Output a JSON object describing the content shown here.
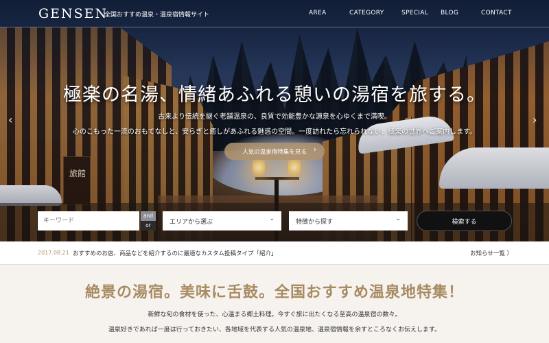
{
  "header": {
    "logo": "GENSEN",
    "tagline": "全国おすすめ温泉・温泉宿情報サイト",
    "nav": [
      "AREA",
      "CATEGORY",
      "SPECIAL",
      "BLOG",
      "CONTACT"
    ]
  },
  "hero": {
    "title": "極楽の名湯、情緒あふれる憩いの湯宿を旅する。",
    "subtitle_line1": "古来より伝統を継ぐ老舗温泉の、良質で効能豊かな源泉を心ゆくまで満喫。",
    "subtitle_line2": "心のこもった一流のおもてなしと、安らぎと癒しがあふれる魅惑の空間。一度訪れたら忘れられない、極楽の世界へご案内します。",
    "feature_button": "人気の温泉宿特集を見る",
    "prev_glyph": "‹",
    "next_glyph": "›",
    "sign_text": "旅館"
  },
  "search": {
    "keyword_placeholder": "キーワード",
    "and_label": "and",
    "or_label": "or",
    "area_select": "エリアから選ぶ",
    "feature_select": "特徴から探す",
    "submit_label": "検索する"
  },
  "news": {
    "date": "2017.08.21",
    "text": "おすすめのお店、商品などを紹介するのに最適なカスタム投稿タイプ「紹介」",
    "all_link": "お知らせ一覧 〉"
  },
  "feature_section": {
    "title": "絶景の湯宿。美味に舌鼓。全国おすすめ温泉地特集！",
    "text_line1": "新鮮な旬の食材を使った、心温まる郷土料理。今すぐ旅に出たくなる至高の温泉宿の数々。",
    "text_line2": "温泉好きであれば一度は行っておきたい、各地域を代表する人気の温泉地、温泉宿情報を余すところなくお伝えします。"
  },
  "colors": {
    "accent": "#a88b62",
    "date": "#b0946e",
    "search_button": "#111111"
  }
}
